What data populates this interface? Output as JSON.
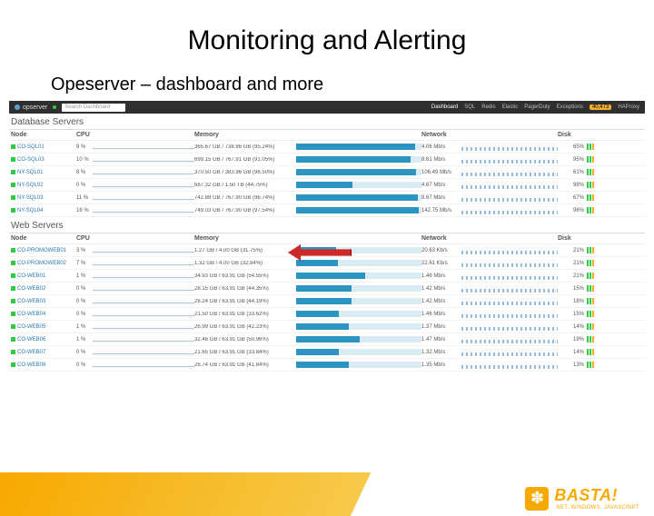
{
  "slide": {
    "title": "Monitoring and Alerting",
    "subtitle": "Opeserver – dashboard and more"
  },
  "nav": {
    "brand": "opserver",
    "search_placeholder": "Search Dashboard",
    "items": [
      "Dashboard",
      "SQL",
      "Redis",
      "Elastic",
      "PagerDuty",
      "Exceptions"
    ],
    "badge": "40,473",
    "last": "HAProxy"
  },
  "sections": {
    "db_title": "Database Servers",
    "web_title": "Web Servers",
    "headers": {
      "node": "Node",
      "cpu": "CPU",
      "memory": "Memory",
      "network": "Network",
      "disk": "Disk"
    }
  },
  "db": [
    {
      "name": "CO-SQL01",
      "cpu": "9 %",
      "mem": "365.67 GB / 738.86 GB (95.24%)",
      "fill": 95,
      "net": "4.06 Mb/s",
      "disk": "65%"
    },
    {
      "name": "CO-SQL03",
      "cpu": "10 %",
      "mem": "699.15 GB / 767.91 GB (91.05%)",
      "fill": 91,
      "net": "8.61 Mb/s",
      "disk": "95%"
    },
    {
      "name": "NY-SQL01",
      "cpu": "8 %",
      "mem": "370.50 GB / 383.96 GB (96.50%)",
      "fill": 96,
      "net": "106.49 Mb/s",
      "disk": "61%"
    },
    {
      "name": "NY-SQL02",
      "cpu": "0 %",
      "mem": "687.32 GB / 1.50 TB (44.75%)",
      "fill": 45,
      "net": "4.67 Mb/s",
      "disk": "98%"
    },
    {
      "name": "NY-SQL03",
      "cpu": "11 %",
      "mem": "742.88 GB / 767.90 GB (96.74%)",
      "fill": 97,
      "net": "8.67 Mb/s",
      "disk": "67%"
    },
    {
      "name": "NY-SQL04",
      "cpu": "16 %",
      "mem": "749.03 GB / 767.90 GB (97.54%)",
      "fill": 98,
      "net": "142.75 Mb/s",
      "disk": "96%"
    }
  ],
  "web": [
    {
      "name": "CO-PROMOWEB01",
      "cpu": "3 %",
      "mem": "1.27 GB / 4.00 GB (31.75%)",
      "fill": 32,
      "net": "20.63 Kb/s",
      "disk": "21%"
    },
    {
      "name": "CO-PROMOWEB02",
      "cpu": "7 %",
      "mem": "1.32 GB / 4.00 GB (32.94%)",
      "fill": 33,
      "net": "22.61 Kb/s",
      "disk": "21%"
    },
    {
      "name": "CO-WEB01",
      "cpu": "1 %",
      "mem": "34.93 GB / 63.91 GB (54.55%)",
      "fill": 55,
      "net": "1.46 Mb/s",
      "disk": "21%"
    },
    {
      "name": "CO-WEB02",
      "cpu": "0 %",
      "mem": "28.15 GB / 63.91 GB (44.35%)",
      "fill": 44,
      "net": "1.42 Mb/s",
      "disk": "15%"
    },
    {
      "name": "CO-WEB03",
      "cpu": "0 %",
      "mem": "28.24 GB / 63.91 GB (44.19%)",
      "fill": 44,
      "net": "1.42 Mb/s",
      "disk": "18%"
    },
    {
      "name": "CO-WEB04",
      "cpu": "0 %",
      "mem": "21.50 GB / 63.91 GB (33.62%)",
      "fill": 34,
      "net": "1.46 Mb/s",
      "disk": "15%"
    },
    {
      "name": "CO-WEB05",
      "cpu": "1 %",
      "mem": "26.99 GB / 63.91 GB (42.23%)",
      "fill": 42,
      "net": "1.37 Mb/s",
      "disk": "14%"
    },
    {
      "name": "CO-WEB06",
      "cpu": "1 %",
      "mem": "32.46 GB / 63.91 GB (50.96%)",
      "fill": 51,
      "net": "1.47 Mb/s",
      "disk": "19%"
    },
    {
      "name": "CO-WEB07",
      "cpu": "0 %",
      "mem": "21.65 GB / 63.91 GB (33.84%)",
      "fill": 34,
      "net": "1.32 Mb/s",
      "disk": "14%"
    },
    {
      "name": "CO-WEB08",
      "cpu": "0 %",
      "mem": "26.74 GB / 63.91 GB (41.84%)",
      "fill": 42,
      "net": "1.35 Mb/s",
      "disk": "13%"
    }
  ],
  "footer": {
    "brand": "BASTA!",
    "tagline": ".NET, WINDOWS, JAVASCRIPT"
  }
}
